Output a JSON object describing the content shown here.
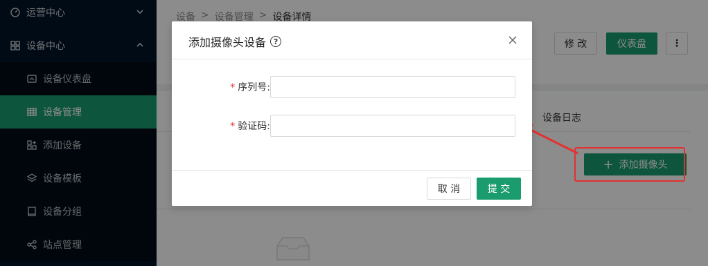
{
  "sidebar": {
    "groups": [
      {
        "label": "运营中心",
        "icon": "dashboard-icon",
        "expanded": false
      },
      {
        "label": "设备中心",
        "icon": "grid-icon",
        "expanded": true
      }
    ],
    "items": [
      {
        "label": "设备仪表盘",
        "icon": "gauge-icon",
        "active": false
      },
      {
        "label": "设备管理",
        "icon": "table-icon",
        "active": true
      },
      {
        "label": "添加设备",
        "icon": "add-device-icon",
        "active": false
      },
      {
        "label": "设备模板",
        "icon": "template-icon",
        "active": false
      },
      {
        "label": "设备分组",
        "icon": "group-icon",
        "active": false
      },
      {
        "label": "站点管理",
        "icon": "site-icon",
        "active": false
      }
    ]
  },
  "breadcrumb": {
    "items": [
      "设备",
      "设备管理"
    ],
    "separator": ">",
    "current": "设备详情"
  },
  "header": {
    "edit_label": "修 改",
    "dashboard_label": "仪表盘",
    "more_label": "⋮"
  },
  "content": {
    "tab_log": "设备日志",
    "add_camera_label": "添加摄像头",
    "add_icon": "+"
  },
  "modal": {
    "title": "添加摄像头设备",
    "help_icon": "?",
    "close_icon": "close-icon",
    "fields": [
      {
        "label": "序列号",
        "required": true,
        "value": "",
        "placeholder": ""
      },
      {
        "label": "验证码",
        "required": true,
        "value": "",
        "placeholder": ""
      }
    ],
    "required_mark": "*",
    "colon": ":",
    "cancel_label": "取 消",
    "submit_label": "提 交"
  },
  "colors": {
    "primary": "#1a9c6f",
    "sidebar_bg": "#001529",
    "annotation": "#e53030"
  }
}
